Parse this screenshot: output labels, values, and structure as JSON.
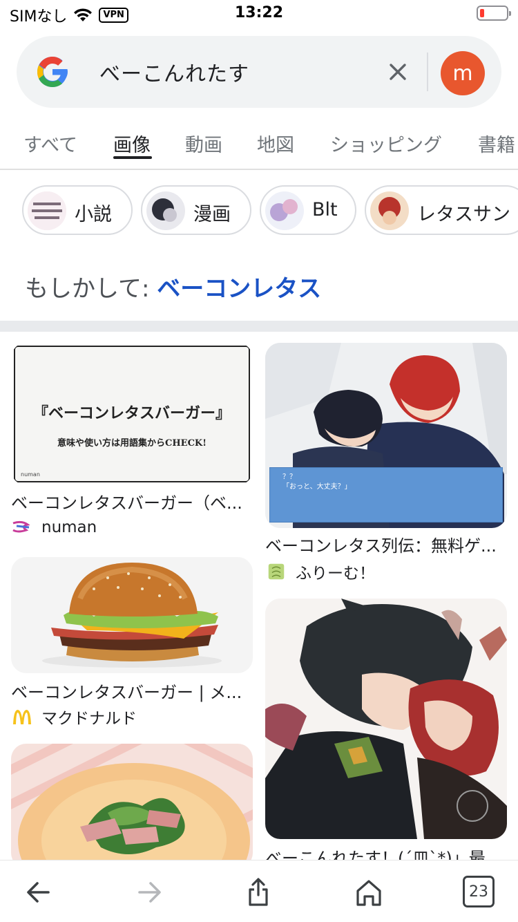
{
  "status_bar": {
    "carrier": "SIMなし",
    "vpn": "VPN",
    "time": "13:22"
  },
  "search": {
    "query": "べーこんれたす",
    "avatar_letter": "m"
  },
  "tabs": [
    {
      "label": "すべて"
    },
    {
      "label": "画像",
      "active": true
    },
    {
      "label": "動画"
    },
    {
      "label": "地図"
    },
    {
      "label": "ショッピング"
    },
    {
      "label": "書籍"
    }
  ],
  "chips": [
    {
      "label": "小説"
    },
    {
      "label": "漫画"
    },
    {
      "label": "Blt"
    },
    {
      "label": "レタスサン"
    }
  ],
  "did_you_mean": {
    "prefix": "もしかして: ",
    "suggestion": "ベーコンレタス"
  },
  "results": {
    "left": [
      {
        "caption": "ベーコンレタスバーガー（ベ...",
        "source": "numan",
        "thumb_heading": "『ベーコンレタスバーガー』",
        "thumb_sub": "意味や使い方は用語集からCHECK!",
        "thumb_brand": "numan"
      },
      {
        "caption": "ベーコンレタスバーガー | メ...",
        "source": "マクドナルド"
      },
      {
        "caption": ""
      }
    ],
    "right": [
      {
        "caption": "ベーコンレタス列伝：無料ゲ...",
        "source": "ふりーむ！",
        "dialog_name": "？？",
        "dialog_line": "「おっと、大丈夫？」"
      },
      {
        "caption": "べーこんれたす！(´皿`*)」最..."
      }
    ]
  },
  "toolbar": {
    "tab_count": "23"
  },
  "colors": {
    "accent_blue": "#1a52c5",
    "avatar": "#e8572e",
    "battery_low": "#ff3b30"
  }
}
